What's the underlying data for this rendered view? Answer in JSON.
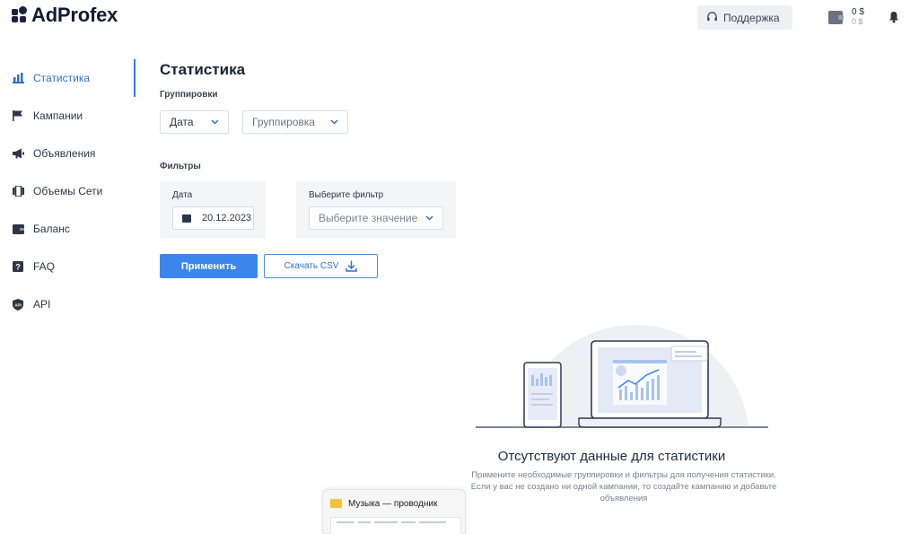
{
  "app": {
    "name": "AdProfex"
  },
  "header": {
    "support_label": "Поддержка",
    "balance_main": "0 $",
    "balance_sub": "0 $"
  },
  "sidebar": {
    "items": [
      {
        "label": "Статистика",
        "icon": "bar-chart-icon",
        "active": true
      },
      {
        "label": "Кампании",
        "icon": "flag-icon"
      },
      {
        "label": "Объявления",
        "icon": "megaphone-icon"
      },
      {
        "label": "Объемы Сети",
        "icon": "network-volume-icon"
      },
      {
        "label": "Баланс",
        "icon": "wallet-icon"
      },
      {
        "label": "FAQ",
        "icon": "question-icon"
      },
      {
        "label": "API",
        "icon": "api-shield-icon"
      }
    ]
  },
  "main": {
    "title": "Статистика",
    "groupings_label": "Группировки",
    "grouping_select_1": "Дата",
    "grouping_select_2": "Группировка",
    "filters_label": "Фильтры",
    "date_filter_label": "Дата",
    "date_value": "20.12.2023",
    "choose_filter_label": "Выберите фильтр",
    "choose_value_placeholder": "Выберите значение",
    "apply_button": "Применить",
    "download_button": "Скачать CSV",
    "empty_title": "Отсутствуют данные для статистики",
    "empty_description": "Примените необходимые группировки и фильтры для получения статистики. Если у вас не создано ни одной кампании, то создайте кампанию и добавьте объявления"
  },
  "taskbar_preview": {
    "title": "Музыка — проводник"
  },
  "colors": {
    "accent": "#3a86ea",
    "active_text": "#2f6fd8",
    "logo": "#141a33"
  }
}
